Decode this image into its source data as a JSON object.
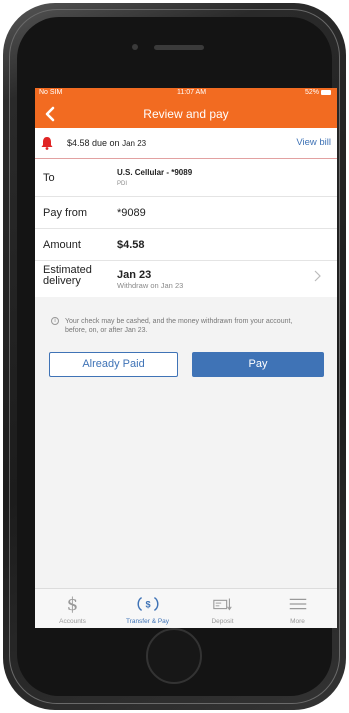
{
  "status_bar": {
    "carrier": "No SIM",
    "time": "11:07 AM",
    "battery": "52%"
  },
  "nav": {
    "title": "Review and pay"
  },
  "bill": {
    "due_text": "$4.58 due on",
    "due_date": "Jan 23",
    "view_bill_label": "View bill"
  },
  "details": {
    "to_label": "To",
    "to_value": "U.S. Cellular - *9089",
    "to_sub": "PDI",
    "pay_from_label": "Pay from",
    "pay_from_value": "*9089",
    "amount_label": "Amount",
    "amount_value": "$4.58",
    "delivery_label_1": "Estimated",
    "delivery_label_2": "delivery",
    "delivery_value": "Jan 23",
    "delivery_sub": "Withdraw on Jan 23"
  },
  "notice": "Your check may be cashed, and the money withdrawn from your account, before, on, or after Jan 23.",
  "buttons": {
    "already_paid": "Already Paid",
    "pay": "Pay"
  },
  "tabs": [
    {
      "label": "Accounts",
      "icon": "dollar-icon"
    },
    {
      "label": "Transfer & Pay",
      "icon": "transfer-pay-icon"
    },
    {
      "label": "Deposit",
      "icon": "check-deposit-icon"
    },
    {
      "label": "More",
      "icon": "menu-icon"
    }
  ],
  "colors": {
    "brand_orange": "#f26b21",
    "link_blue": "#3f73b6",
    "bell_red": "#e02424"
  }
}
